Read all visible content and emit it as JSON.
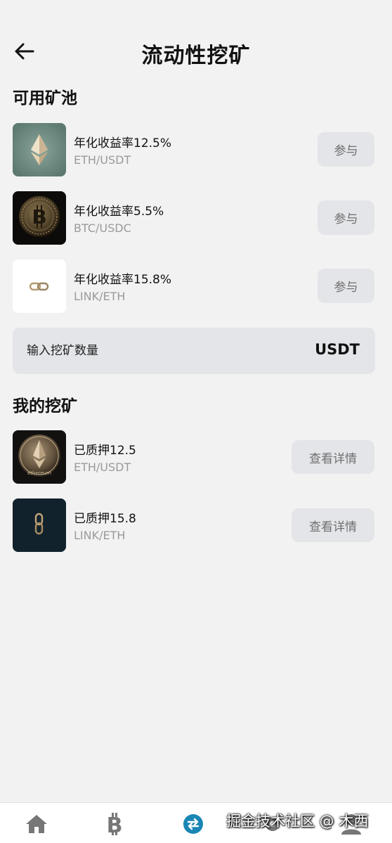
{
  "header": {
    "title": "流动性挖矿"
  },
  "available_pools": {
    "title": "可用矿池",
    "items": [
      {
        "rate_label": "年化收益率12.5%",
        "pair": "ETH/USDT",
        "icon": "ethereum-icon",
        "button": "参与"
      },
      {
        "rate_label": "年化收益率5.5%",
        "pair": "BTC/USDC",
        "icon": "bitcoin-coin-icon",
        "button": "参与"
      },
      {
        "rate_label": "年化收益率15.8%",
        "pair": "LINK/ETH",
        "icon": "chain-link-icon",
        "button": "参与"
      }
    ]
  },
  "amount_input": {
    "placeholder": "输入挖矿数量",
    "unit": "USDT"
  },
  "my_mining": {
    "title": "我的挖矿",
    "items": [
      {
        "staked_label": "已质押12.5",
        "pair": "ETH/USDT",
        "icon": "ethereum-coin-icon",
        "button": "查看详情"
      },
      {
        "staked_label": "已质押15.8",
        "pair": "LINK/ETH",
        "icon": "chain-link-icon",
        "button": "查看详情"
      }
    ]
  },
  "bottom_nav": {
    "items": [
      {
        "icon": "home-icon"
      },
      {
        "icon": "bitcoin-icon"
      },
      {
        "icon": "swap-icon",
        "active": true
      },
      {
        "icon": "settings-icon"
      },
      {
        "icon": "user-icon"
      }
    ]
  },
  "colors": {
    "accent": "#1a86b5",
    "button_bg": "#e4e5e9",
    "page_bg": "#f2f2f2"
  },
  "watermark": "掘金技术社区 @ 木西"
}
